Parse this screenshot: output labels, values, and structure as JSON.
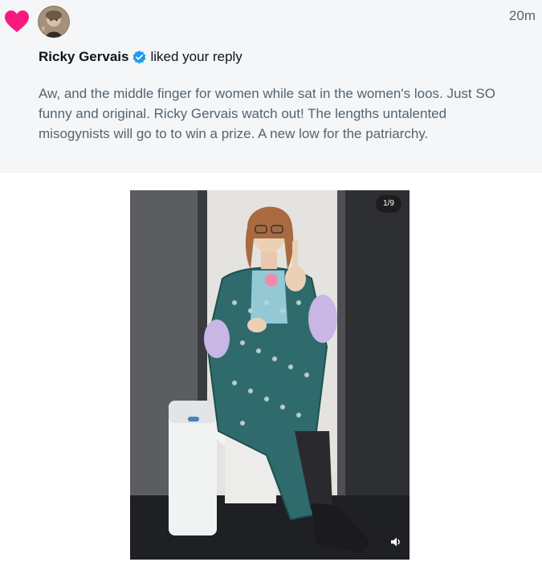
{
  "notification": {
    "timestamp": "20m",
    "user": {
      "name": "Ricky Gervais",
      "verified": true
    },
    "action": "liked your reply",
    "reply_text": "Aw, and the middle finger for women while sat in the women's loos. Just SO funny and original. Ricky Gervais watch out! The lengths untalented misogynists will go to to win a prize. A new low for the patriarchy."
  },
  "media": {
    "counter": "1/9"
  },
  "icons": {
    "heart": "heart-icon",
    "verified": "verified-badge-icon",
    "volume": "volume-icon"
  },
  "colors": {
    "heart": "#f91880",
    "verified": "#1d9bf0",
    "background": "#f5f6f7",
    "muted_text": "#536471"
  }
}
